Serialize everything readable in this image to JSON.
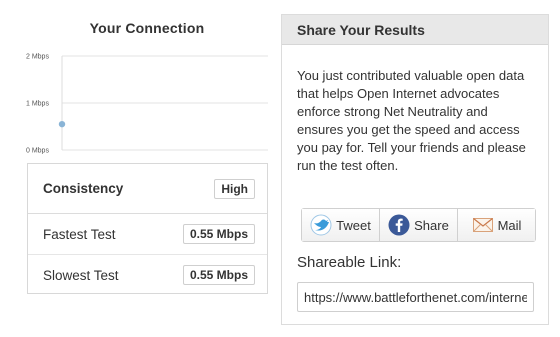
{
  "connection": {
    "title": "Your Connection",
    "chart_data": {
      "type": "scatter",
      "title": "",
      "xlabel": "",
      "ylabel": "",
      "y_tick_labels": [
        "0 Mbps",
        "1 Mbps",
        "2 Mbps"
      ],
      "ylim": [
        0,
        2
      ],
      "grid": true,
      "series": [
        {
          "x": [
            0
          ],
          "y": [
            0.55
          ]
        }
      ],
      "colors": {
        "point": "#8ab4d6",
        "grid": "#e3e3e3",
        "axis": "#dddddd"
      }
    },
    "stats": {
      "consistency_label": "Consistency",
      "consistency_value": "High",
      "fastest_label": "Fastest Test",
      "fastest_value": "0.55 Mbps",
      "slowest_label": "Slowest Test",
      "slowest_value": "0.55 Mbps"
    }
  },
  "share": {
    "title": "Share Your Results",
    "text": "You just contributed valuable open data that helps Open Internet advocates enforce strong Net Neutrality and ensures you get the speed and access you pay for. Tell your friends and please run the test often.",
    "buttons": {
      "tweet_label": "Tweet",
      "tweet_icon": "twitter-bird-icon",
      "facebook_label": "Share",
      "facebook_icon": "facebook-icon",
      "mail_label": "Mail",
      "mail_icon": "envelope-icon"
    },
    "link_label": "Shareable Link:",
    "link_value": "https://www.battleforthenet.com/internethealthtest"
  }
}
